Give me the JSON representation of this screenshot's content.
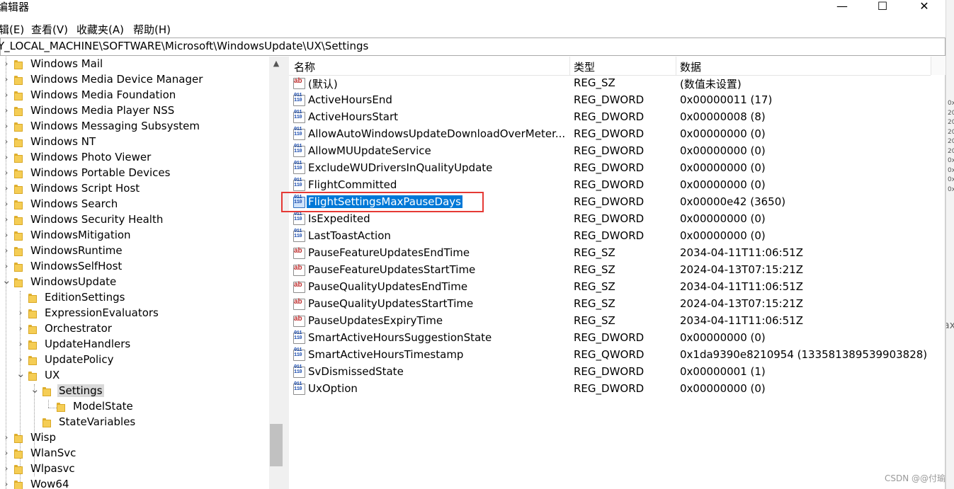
{
  "window": {
    "title": "编辑器",
    "controls": {
      "minimize": "—",
      "maximize": "☐",
      "close": "✕"
    }
  },
  "menu": [
    "辑(E)",
    "查看(V)",
    "收藏夹(A)",
    "帮助(H)"
  ],
  "address": "Y_LOCAL_MACHINE\\SOFTWARE\\Microsoft\\WindowsUpdate\\UX\\Settings",
  "tree": [
    {
      "label": "Windows Mail",
      "level": 0,
      "expander": "collapsed"
    },
    {
      "label": "Windows Media Device Manager",
      "level": 0,
      "expander": "collapsed"
    },
    {
      "label": "Windows Media Foundation",
      "level": 0,
      "expander": "collapsed"
    },
    {
      "label": "Windows Media Player NSS",
      "level": 0,
      "expander": "collapsed"
    },
    {
      "label": "Windows Messaging Subsystem",
      "level": 0,
      "expander": "collapsed"
    },
    {
      "label": "Windows NT",
      "level": 0,
      "expander": "collapsed"
    },
    {
      "label": "Windows Photo Viewer",
      "level": 0,
      "expander": "collapsed"
    },
    {
      "label": "Windows Portable Devices",
      "level": 0,
      "expander": "collapsed"
    },
    {
      "label": "Windows Script Host",
      "level": 0,
      "expander": "collapsed"
    },
    {
      "label": "Windows Search",
      "level": 0,
      "expander": "collapsed"
    },
    {
      "label": "Windows Security Health",
      "level": 0,
      "expander": "collapsed"
    },
    {
      "label": "WindowsMitigation",
      "level": 0,
      "expander": "collapsed"
    },
    {
      "label": "WindowsRuntime",
      "level": 0,
      "expander": "collapsed"
    },
    {
      "label": "WindowsSelfHost",
      "level": 0,
      "expander": "collapsed"
    },
    {
      "label": "WindowsUpdate",
      "level": 0,
      "expander": "expanded"
    },
    {
      "label": "EditionSettings",
      "level": 1,
      "expander": "none"
    },
    {
      "label": "ExpressionEvaluators",
      "level": 1,
      "expander": "collapsed"
    },
    {
      "label": "Orchestrator",
      "level": 1,
      "expander": "collapsed"
    },
    {
      "label": "UpdateHandlers",
      "level": 1,
      "expander": "collapsed"
    },
    {
      "label": "UpdatePolicy",
      "level": 1,
      "expander": "collapsed"
    },
    {
      "label": "UX",
      "level": 1,
      "expander": "expanded"
    },
    {
      "label": "Settings",
      "level": 2,
      "expander": "expanded",
      "selected": true
    },
    {
      "label": "ModelState",
      "level": 3,
      "expander": "none"
    },
    {
      "label": "StateVariables",
      "level": 2,
      "expander": "none"
    },
    {
      "label": "Wisp",
      "level": 0,
      "expander": "collapsed"
    },
    {
      "label": "WlanSvc",
      "level": 0,
      "expander": "collapsed"
    },
    {
      "label": "Wlpasvc",
      "level": 0,
      "expander": "collapsed"
    },
    {
      "label": "Wow64",
      "level": 0,
      "expander": "collapsed"
    }
  ],
  "columns": {
    "name": "名称",
    "type": "类型",
    "data": "数据"
  },
  "values": [
    {
      "icon": "string-value-icon",
      "kind": "sz",
      "name": "(默认)",
      "type": "REG_SZ",
      "data": "(数值未设置)"
    },
    {
      "icon": "binary-value-icon",
      "kind": "dw",
      "name": "ActiveHoursEnd",
      "type": "REG_DWORD",
      "data": "0x00000011 (17)"
    },
    {
      "icon": "binary-value-icon",
      "kind": "dw",
      "name": "ActiveHoursStart",
      "type": "REG_DWORD",
      "data": "0x00000008 (8)"
    },
    {
      "icon": "binary-value-icon",
      "kind": "dw",
      "name": "AllowAutoWindowsUpdateDownloadOverMeter...",
      "type": "REG_DWORD",
      "data": "0x00000000 (0)"
    },
    {
      "icon": "binary-value-icon",
      "kind": "dw",
      "name": "AllowMUUpdateService",
      "type": "REG_DWORD",
      "data": "0x00000000 (0)"
    },
    {
      "icon": "binary-value-icon",
      "kind": "dw",
      "name": "ExcludeWUDriversInQualityUpdate",
      "type": "REG_DWORD",
      "data": "0x00000000 (0)"
    },
    {
      "icon": "binary-value-icon",
      "kind": "dw",
      "name": "FlightCommitted",
      "type": "REG_DWORD",
      "data": "0x00000000 (0)"
    },
    {
      "icon": "binary-value-icon",
      "kind": "dw",
      "name": "FlightSettingsMaxPauseDays",
      "type": "REG_DWORD",
      "data": "0x00000e42 (3650)",
      "selected": true
    },
    {
      "icon": "binary-value-icon",
      "kind": "dw",
      "name": "IsExpedited",
      "type": "REG_DWORD",
      "data": "0x00000000 (0)"
    },
    {
      "icon": "binary-value-icon",
      "kind": "dw",
      "name": "LastToastAction",
      "type": "REG_DWORD",
      "data": "0x00000000 (0)"
    },
    {
      "icon": "string-value-icon",
      "kind": "sz",
      "name": "PauseFeatureUpdatesEndTime",
      "type": "REG_SZ",
      "data": "2034-04-11T11:06:51Z"
    },
    {
      "icon": "string-value-icon",
      "kind": "sz",
      "name": "PauseFeatureUpdatesStartTime",
      "type": "REG_SZ",
      "data": "2024-04-13T07:15:21Z"
    },
    {
      "icon": "string-value-icon",
      "kind": "sz",
      "name": "PauseQualityUpdatesEndTime",
      "type": "REG_SZ",
      "data": "2034-04-11T11:06:51Z"
    },
    {
      "icon": "string-value-icon",
      "kind": "sz",
      "name": "PauseQualityUpdatesStartTime",
      "type": "REG_SZ",
      "data": "2024-04-13T07:15:21Z"
    },
    {
      "icon": "string-value-icon",
      "kind": "sz",
      "name": "PauseUpdatesExpiryTime",
      "type": "REG_SZ",
      "data": "2034-04-11T11:06:51Z"
    },
    {
      "icon": "binary-value-icon",
      "kind": "dw",
      "name": "SmartActiveHoursSuggestionState",
      "type": "REG_DWORD",
      "data": "0x00000000 (0)"
    },
    {
      "icon": "binary-value-icon",
      "kind": "dw",
      "name": "SmartActiveHoursTimestamp",
      "type": "REG_QWORD",
      "data": "0x1da9390e8210954 (133581389539903828)"
    },
    {
      "icon": "binary-value-icon",
      "kind": "dw",
      "name": "SvDismissedState",
      "type": "REG_DWORD",
      "data": "0x00000001 (1)"
    },
    {
      "icon": "binary-value-icon",
      "kind": "dw",
      "name": "UxOption",
      "type": "REG_DWORD",
      "data": "0x00000000 (0)"
    }
  ],
  "icon_glyphs": {
    "sz": "ab",
    "dw": "011\n110"
  },
  "background_fragments": [
    "0x",
    "20",
    "20",
    "20",
    "20",
    "20",
    "0x",
    "0x",
    "0x",
    "0x"
  ],
  "background_fragment_x": "ax",
  "watermark": "CSDN @@付瑜",
  "colors": {
    "selection": "#0078d7",
    "highlight_box": "#e53935",
    "folder": "#f5cd55"
  }
}
